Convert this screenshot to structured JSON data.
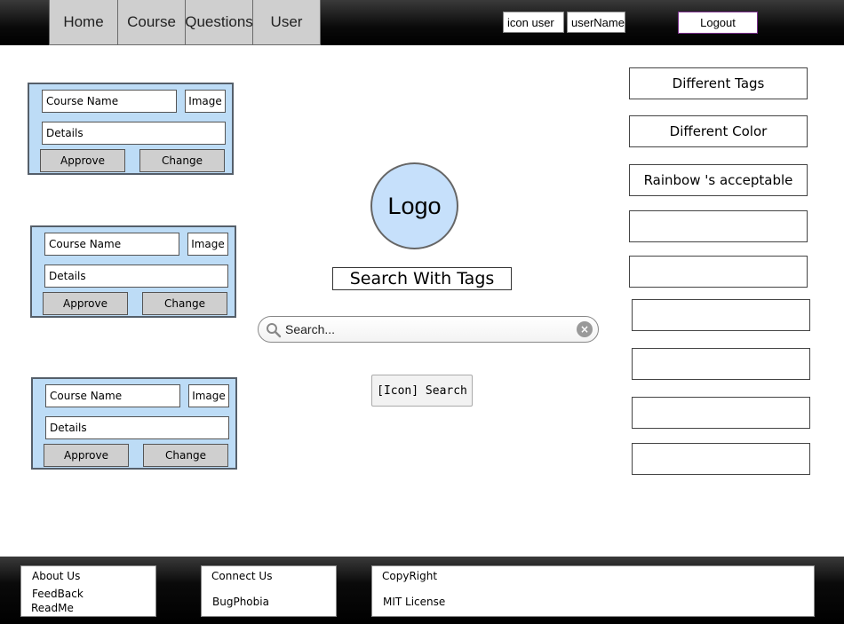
{
  "nav": {
    "tabs": [
      {
        "label": "Home"
      },
      {
        "label": "Course"
      },
      {
        "label": "Questions"
      },
      {
        "label": "User"
      }
    ],
    "icon_user": "icon user",
    "user_name": "userName",
    "logout_label": "Logout"
  },
  "courses": [
    {
      "name": "Course Name",
      "image": "Image",
      "details": "Details",
      "approve": "Approve",
      "change": "Change"
    },
    {
      "name": "Course Name",
      "image": "Image",
      "details": "Details",
      "approve": "Approve",
      "change": "Change"
    },
    {
      "name": "Course Name",
      "image": "Image",
      "details": "Details",
      "approve": "Approve",
      "change": "Change"
    }
  ],
  "center": {
    "logo": "Logo",
    "tags_title": "Search With Tags",
    "search_placeholder": "Search...",
    "search_button": "[Icon] Search"
  },
  "tags": [
    {
      "label": "Different Tags"
    },
    {
      "label": "Different Color"
    },
    {
      "label": "Rainbow 's acceptable"
    },
    {
      "label": ""
    },
    {
      "label": ""
    },
    {
      "label": ""
    },
    {
      "label": ""
    },
    {
      "label": ""
    },
    {
      "label": ""
    }
  ],
  "footer": {
    "about": "About Us",
    "feedback": "FeedBack",
    "readme": "ReadMe",
    "connect": "Connect Us",
    "bugphobia": "BugPhobia",
    "copyright": "CopyRight",
    "license": "MIT License"
  },
  "colors": {
    "card_bg": "#bddcf6",
    "logo_bg": "#c6e0fb",
    "nav_tab_bg": "#cfcfcf",
    "bar_bg": "#000000"
  }
}
